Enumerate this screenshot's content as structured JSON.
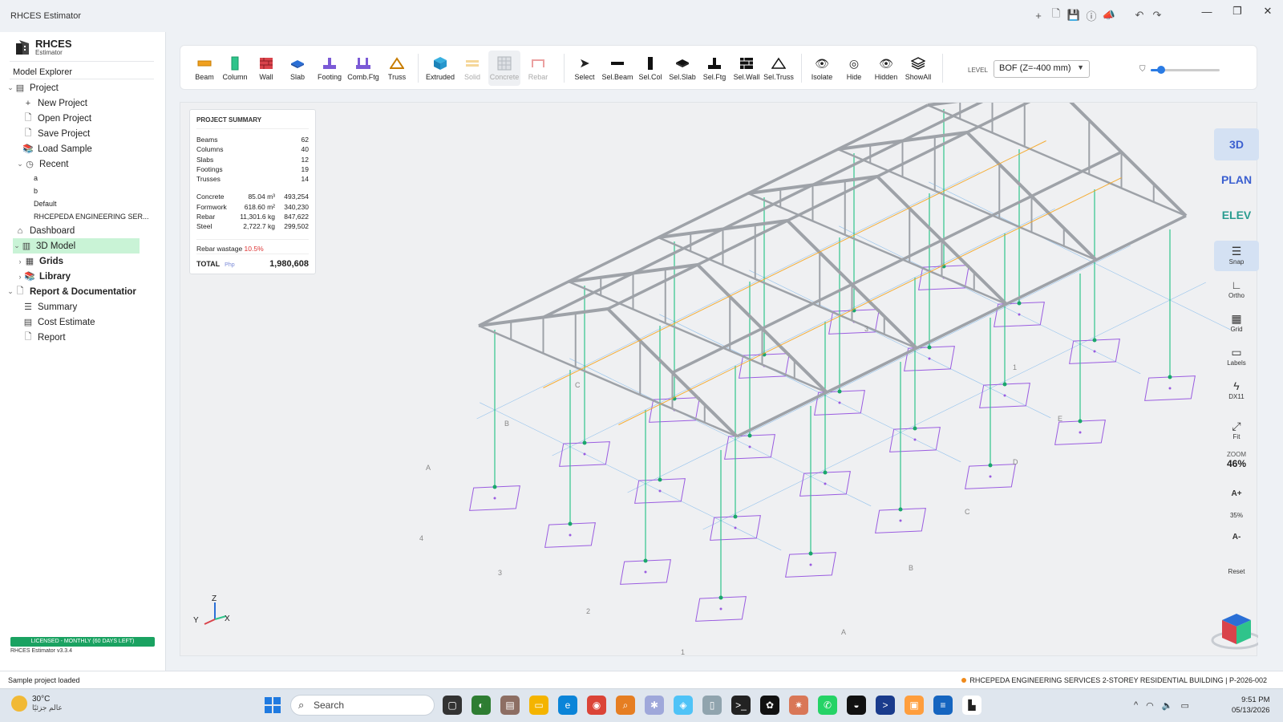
{
  "window": {
    "title": "RHCES Estimator",
    "min_icon": "minimize-icon",
    "max_icon": "restore-icon",
    "close_icon": "close-icon"
  },
  "titlebar_icons": [
    "add-icon",
    "new-file-icon",
    "save-icon",
    "info-icon",
    "megaphone-icon",
    "undo-icon",
    "redo-icon"
  ],
  "sidebar": {
    "logo_name": "RHCES",
    "logo_sub": "Estimator",
    "section_title": "Model Explorer",
    "tree": {
      "project": "Project",
      "new_project": "New Project",
      "open_project": "Open Project",
      "save_project": "Save Project",
      "load_sample": "Load Sample",
      "recent": "Recent",
      "recent_items": [
        "a",
        "b",
        "Default",
        "RHCEPEDA ENGINEERING SER..."
      ],
      "dashboard": "Dashboard",
      "model_3d": "3D Model",
      "grids": "Grids",
      "library": "Library",
      "report_doc": "Report & Documentatior",
      "summary": "Summary",
      "cost_estimate": "Cost Estimate",
      "report": "Report"
    },
    "license": "LICENSED - MONTHLY (60 DAYS LEFT)",
    "version": "RHCES Estimator v3.3.4"
  },
  "toolbar": {
    "tools": {
      "beam": "Beam",
      "column": "Column",
      "wall": "Wall",
      "slab": "Slab",
      "footing": "Footing",
      "comb_ftg": "Comb.Ftg",
      "truss": "Truss",
      "extruded": "Extruded",
      "solid": "Solid",
      "concrete": "Concrete",
      "rebar": "Rebar",
      "select": "Select",
      "sel_beam": "Sel.Beam",
      "sel_col": "Sel.Col",
      "sel_slab": "Sel.Slab",
      "sel_ftg": "Sel.Ftg",
      "sel_wall": "Sel.Wall",
      "sel_truss": "Sel.Truss",
      "isolate": "Isolate",
      "hide": "Hide",
      "hidden": "Hidden",
      "show_all": "ShowAll"
    },
    "level_label": "LEVEL",
    "level_value": "BOF (Z=-400 mm)",
    "opacity_fraction": 0.15
  },
  "summary": {
    "header": "PROJECT SUMMARY",
    "counts": [
      {
        "label": "Beams",
        "value": "62"
      },
      {
        "label": "Columns",
        "value": "40"
      },
      {
        "label": "Slabs",
        "value": "12"
      },
      {
        "label": "Footings",
        "value": "19"
      },
      {
        "label": "Trusses",
        "value": "14"
      }
    ],
    "costs": [
      {
        "label": "Concrete",
        "qty": "85.04 m³",
        "amount": "493,254"
      },
      {
        "label": "Formwork",
        "qty": "618.60 m²",
        "amount": "340,230"
      },
      {
        "label": "Rebar",
        "qty": "11,301.6 kg",
        "amount": "847,622"
      },
      {
        "label": "Steel",
        "qty": "2,722.7 kg",
        "amount": "299,502"
      }
    ],
    "wastage_label": "Rebar wastage",
    "wastage_value": "10.5%",
    "total_label": "TOTAL",
    "total_currency": "Php",
    "total_value": "1,980,608"
  },
  "view_panel": {
    "view_3d": "3D",
    "view_plan": "PLAN",
    "view_elev": "ELEV",
    "snap": "Snap",
    "ortho": "Ortho",
    "grid": "Grid",
    "labels": "Labels",
    "dx11": "DX11",
    "fit": "Fit",
    "zoom_label": "ZOOM",
    "zoom_value": "46%",
    "font_up": "A+",
    "font_pct": "35%",
    "font_down": "A-",
    "reset": "Reset"
  },
  "axes": {
    "z": "Z",
    "y": "Y",
    "x": "X"
  },
  "grid_labels": {
    "a_left": "A",
    "b_left": "B",
    "c_left": "C",
    "one_right": "1",
    "e_right": "E",
    "d_right": "D",
    "c_right": "C",
    "b_right": "B",
    "a_bottom": "A",
    "n4": "4",
    "n3": "3",
    "n2": "2",
    "n1": "1",
    "n3b": "3"
  },
  "statusbar": {
    "left": "Sample project loaded",
    "right": "RHCEPEDA ENGINEERING SERVICES 2-STOREY RESIDENTIAL BUILDING  |  P-2026-002"
  },
  "taskbar": {
    "temp": "30°C",
    "weather_text": "عالم جزئيًا",
    "search_placeholder": "Search",
    "time": "9:51 PM",
    "date": "05/13/2026"
  },
  "colors": {
    "accent": "#3b5fd0",
    "column": "#2fc48b",
    "footing": "#9a5ce0",
    "truss": "#9ea2a8",
    "license": "#1aa261",
    "grid_blue": "#4a9de8",
    "rebar_orange": "#f5a623"
  }
}
